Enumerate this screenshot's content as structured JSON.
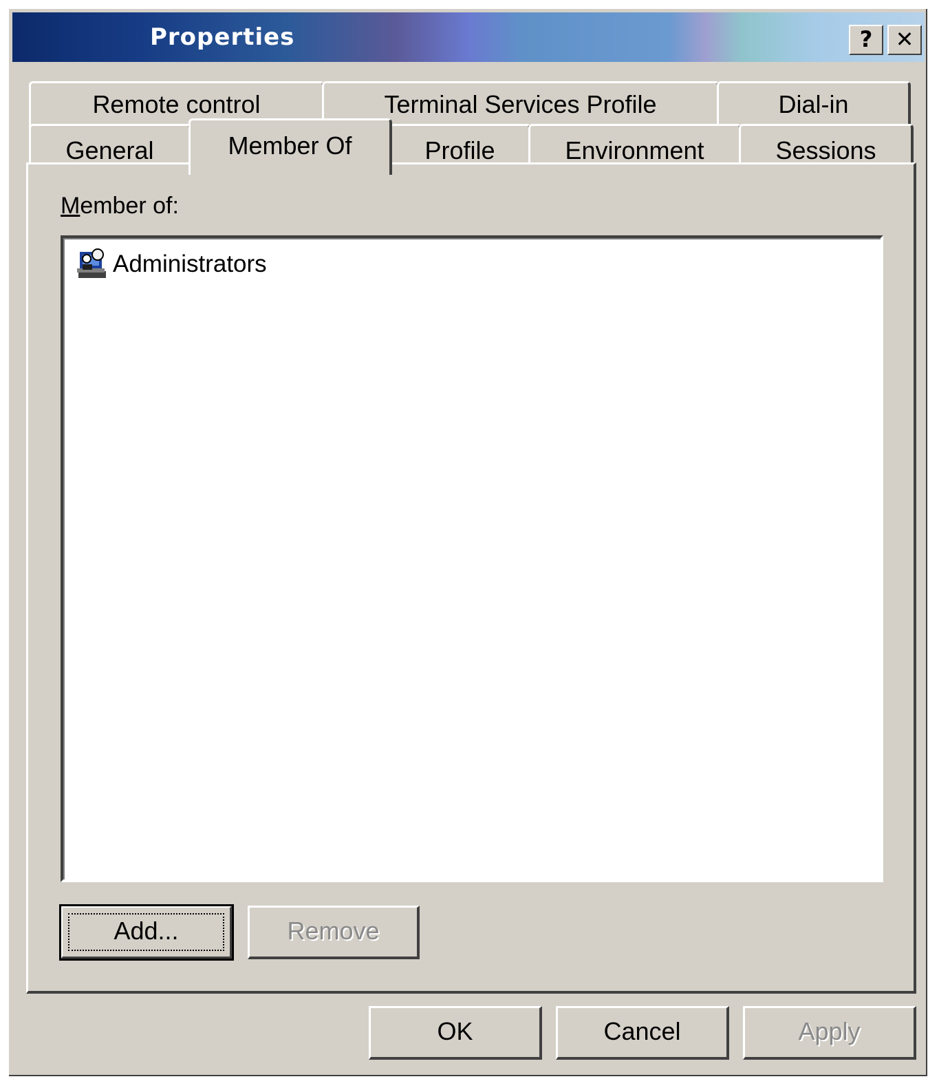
{
  "window": {
    "title": "Properties",
    "help_button": "?",
    "close_button": "✕"
  },
  "tabs": {
    "row1": [
      "Remote control",
      "Terminal Services Profile",
      "Dial-in"
    ],
    "row2": [
      "General",
      "Member Of",
      "Profile",
      "Environment",
      "Sessions"
    ],
    "active": "Member Of"
  },
  "member_of": {
    "label_underlined": "M",
    "label_rest": "ember of:",
    "items": [
      {
        "name": "Administrators",
        "icon": "group-icon"
      }
    ]
  },
  "buttons": {
    "add": "Add...",
    "remove": "Remove",
    "ok": "OK",
    "cancel": "Cancel",
    "apply": "Apply"
  },
  "colors": {
    "face": "#d4d0c8",
    "title_start": "#0c2a6b",
    "title_end": "#b6d2ea"
  }
}
